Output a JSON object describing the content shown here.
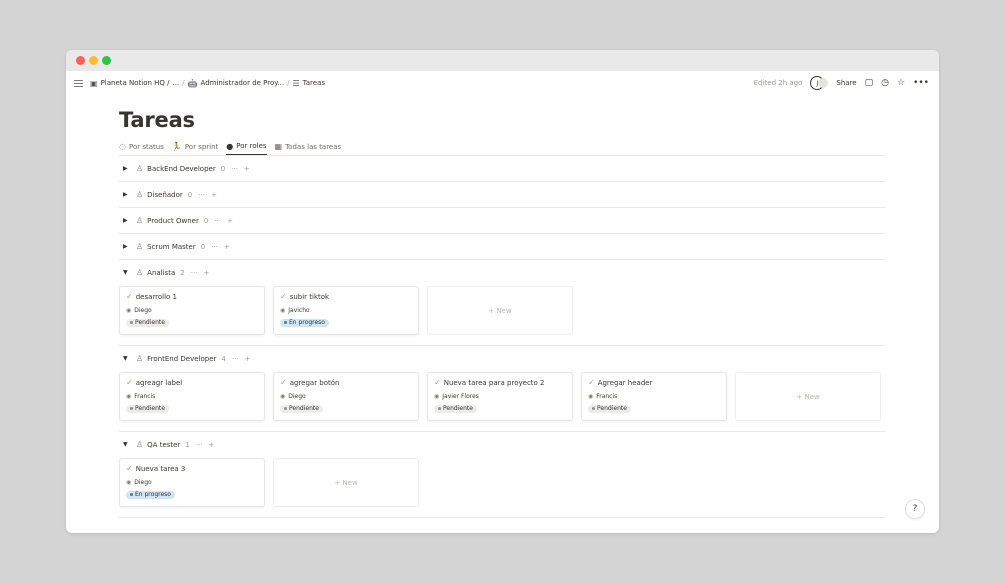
{
  "breadcrumb": {
    "workspace": "Planeta Notion HQ /",
    "ellipsis": "...",
    "sep1": "/",
    "parent": "Administrador de Proy...",
    "sep2": "/",
    "current": "Tareas"
  },
  "topbar": {
    "edited": "Edited 2h ago",
    "avatar_initial": "J",
    "share": "Share"
  },
  "page": {
    "title": "Tareas"
  },
  "tabs": [
    {
      "label": "Por status",
      "icon": "loader-icon"
    },
    {
      "label": "Por sprint",
      "icon": "run-icon"
    },
    {
      "label": "Por roles",
      "icon": "person-icon",
      "active": true
    },
    {
      "label": "Todas las tareas",
      "icon": "table-icon"
    }
  ],
  "group_controls": {
    "more": "···",
    "add": "+"
  },
  "new_label": "+ New",
  "groups": [
    {
      "name": "BackEnd Developer",
      "count": "0",
      "expanded": false,
      "caret": "▶",
      "cards": []
    },
    {
      "name": "Diseñador",
      "count": "0",
      "expanded": false,
      "caret": "▶",
      "cards": []
    },
    {
      "name": "Product Owner",
      "count": "0",
      "expanded": false,
      "caret": "▶",
      "cards": []
    },
    {
      "name": "Scrum Master",
      "count": "0",
      "expanded": false,
      "caret": "▶",
      "cards": []
    },
    {
      "name": "Analista",
      "count": "2",
      "expanded": true,
      "caret": "▼",
      "cards": [
        {
          "title": "desarrollo 1",
          "person": "Diego",
          "status": "Pendiente",
          "status_type": "pend"
        },
        {
          "title": "subir tiktok",
          "person": "Javicho",
          "status": "En progreso",
          "status_type": "prog"
        }
      ]
    },
    {
      "name": "FrontEnd Developer",
      "count": "4",
      "expanded": true,
      "caret": "▼",
      "cards": [
        {
          "title": "agreagr label",
          "person": "Francis",
          "status": "Pendiente",
          "status_type": "pend"
        },
        {
          "title": "agregar botón",
          "person": "Diego",
          "status": "Pendiente",
          "status_type": "pend"
        },
        {
          "title": "Nueva tarea para proyecto 2",
          "person": "Javier Flores",
          "status": "Pendiente",
          "status_type": "pend"
        },
        {
          "title": "Agregar header",
          "person": "Francis",
          "status": "Pendiente",
          "status_type": "pend"
        }
      ]
    },
    {
      "name": "QA tester",
      "count": "1",
      "expanded": true,
      "caret": "▼",
      "cards": [
        {
          "title": "Nueva tarea 3",
          "person": "Diego",
          "status": "En progreso",
          "status_type": "prog"
        }
      ]
    }
  ],
  "help": "?",
  "colors": {
    "pending_badge": "#ececea",
    "progress_badge": "#d3e5ef",
    "text": "#37352f"
  }
}
